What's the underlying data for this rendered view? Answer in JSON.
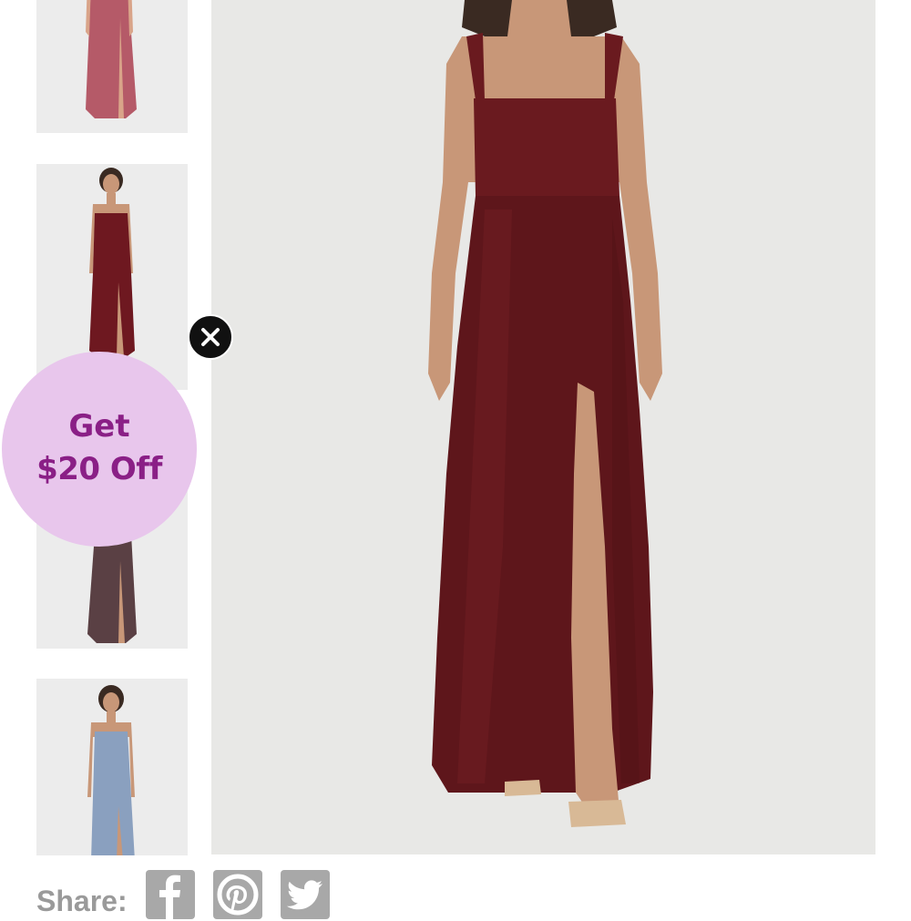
{
  "thumbnails": [
    {
      "name": "thumbnail-rose-dress",
      "color": "#b55a68"
    },
    {
      "name": "thumbnail-burgundy-dress",
      "color": "#6e1820"
    },
    {
      "name": "thumbnail-mocha-dress",
      "color": "#5a4044"
    },
    {
      "name": "thumbnail-blue-dress",
      "color": "#8aa0bf"
    }
  ],
  "main_image": {
    "dress_color": "#6a1a1f",
    "skin_color": "#c89778",
    "background": "#e8e8e6"
  },
  "close_icon": "close-icon",
  "promo": {
    "line1": "Get",
    "line2": "$20 Off",
    "background": "#e8c6ec",
    "text_color": "#8a1f86"
  },
  "share": {
    "label": "Share:",
    "icons": [
      "facebook-icon",
      "pinterest-icon",
      "twitter-icon"
    ]
  }
}
